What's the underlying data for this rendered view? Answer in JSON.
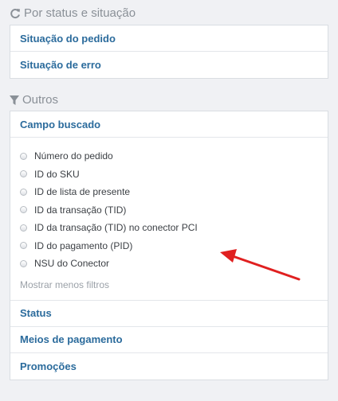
{
  "status_section": {
    "icon": "refresh-icon",
    "title": "Por status e situação",
    "rows": [
      "Situação do pedido",
      "Situação de erro"
    ]
  },
  "others_section": {
    "icon": "filter-icon",
    "title": "Outros",
    "field_header": "Campo buscado",
    "options": [
      "Número do pedido",
      "ID do SKU",
      "ID de lista de presente",
      "ID da transação (TID)",
      "ID da transação (TID) no conector PCI",
      "ID do pagamento (PID)",
      "NSU do Conector"
    ],
    "show_less": "Mostrar menos filtros",
    "rows": [
      "Status",
      "Meios de pagamento",
      "Promoções"
    ]
  },
  "colors": {
    "link": "#2b6b9c",
    "muted": "#8a9097",
    "arrow": "#e02020"
  }
}
